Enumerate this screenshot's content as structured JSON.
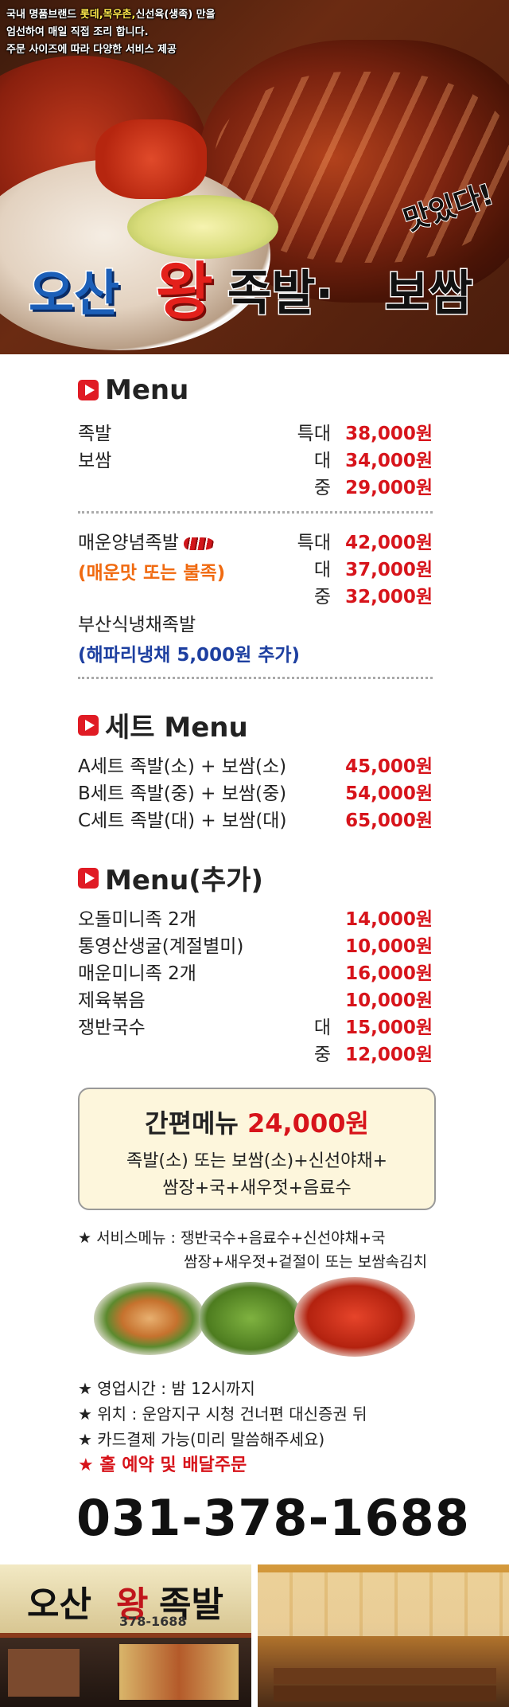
{
  "hero": {
    "intro_line1_a": "국내 명품브랜드 ",
    "intro_line1_brand": "롯데,목우촌,",
    "intro_line1_b": "신선육(생족) 만을",
    "intro_line2": "엄선하여 매일 직접 조리 합니다.",
    "intro_line3": "주문 사이즈에 따라 다양한 서비스 제공",
    "slogan": "맛있다!",
    "logo_w1": "오산",
    "logo_w2": "왕",
    "logo_w3": "족발·",
    "logo_w4": "보쌈"
  },
  "menu": {
    "title": "Menu",
    "group1": [
      {
        "name": "족발",
        "size": "특대",
        "price": "38,000원"
      },
      {
        "name": "보쌈",
        "size": "대",
        "price": "34,000원"
      },
      {
        "name": "",
        "size": "중",
        "price": "29,000원"
      }
    ],
    "group2": [
      {
        "name": "매운양념족발",
        "size": "특대",
        "price": "42,000원"
      },
      {
        "name": "",
        "size": "대",
        "price": "37,000원"
      },
      {
        "name": "",
        "size": "중",
        "price": "32,000원"
      }
    ],
    "group2_note": "(매운맛 또는 불족)",
    "busan": "부산식냉채족발",
    "busan_note": "(해파리냉채 5,000원 추가)"
  },
  "set_menu": {
    "title": "세트 Menu",
    "items": [
      {
        "name": "A세트 족발(소) + 보쌈(소)",
        "price": "45,000원"
      },
      {
        "name": "B세트 족발(중) + 보쌈(중)",
        "price": "54,000원"
      },
      {
        "name": "C세트 족발(대) + 보쌈(대)",
        "price": "65,000원"
      }
    ]
  },
  "extra_menu": {
    "title": "Menu(추가)",
    "items": [
      {
        "name": "오돌미니족 2개",
        "size": "",
        "price": "14,000원"
      },
      {
        "name": "통영산생굴(계절별미)",
        "size": "",
        "price": "10,000원"
      },
      {
        "name": "매운미니족 2개",
        "size": "",
        "price": "16,000원"
      },
      {
        "name": "제육볶음",
        "size": "",
        "price": "10,000원"
      },
      {
        "name": "쟁반국수",
        "size": "대",
        "price": "15,000원"
      },
      {
        "name": "",
        "size": "중",
        "price": "12,000원"
      }
    ]
  },
  "simple_menu": {
    "title": "간편메뉴",
    "price": "24,000원",
    "line1": "족발(소) 또는 보쌈(소)+신선야채+",
    "line2": "쌈장+국+새우젓+음료수"
  },
  "service": {
    "line1": "★ 서비스메뉴 : 쟁반국수+음료수+신선야채+국",
    "line2": "쌈장+새우젓+겉절이 또는 보쌈속김치"
  },
  "info": {
    "hours": "★ 영업시간 : 밤 12시까지",
    "location": "★ 위치 : 운암지구 시청 건너편 대신증권 뒤",
    "card": "★ 카드결제 가능(미리 말씀해주세요)",
    "reserve": "★ 홀 예약 및 배달주문",
    "phone": "031-378-1688"
  },
  "storefront": {
    "sign_w1": "오산",
    "sign_w2": "왕",
    "sign_w3": "족발",
    "sign_phone": "378-1688"
  }
}
